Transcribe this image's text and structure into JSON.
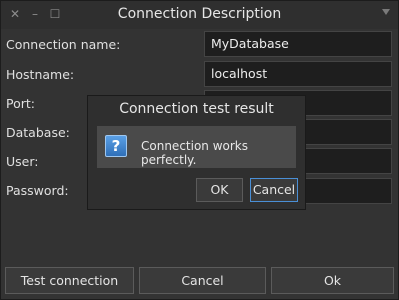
{
  "window": {
    "title": "Connection Description",
    "controls": {
      "close_icon": "close-icon",
      "minimize_icon": "minimize-icon",
      "maximize_icon": "maximize-icon",
      "menu_icon": "chevron-down-icon"
    }
  },
  "form": {
    "fields": [
      {
        "label": "Connection name:",
        "value": "MyDatabase"
      },
      {
        "label": "Hostname:",
        "value": "localhost"
      },
      {
        "label": "Port:",
        "value": ""
      },
      {
        "label": "Database:",
        "value": ""
      },
      {
        "label": "User:",
        "value": ""
      },
      {
        "label": "Password:",
        "value": ""
      }
    ]
  },
  "buttons": {
    "test": "Test connection",
    "cancel": "Cancel",
    "ok": "Ok"
  },
  "dialog": {
    "title": "Connection test result",
    "message": "Connection works perfectly.",
    "icon": "question-icon",
    "ok": "OK",
    "cancel": "Cancel"
  },
  "colors": {
    "background": "#333333",
    "field_bg": "#1e1e1e",
    "focus_accent": "#4a8fd6",
    "icon_blue": "#3f84d2"
  }
}
